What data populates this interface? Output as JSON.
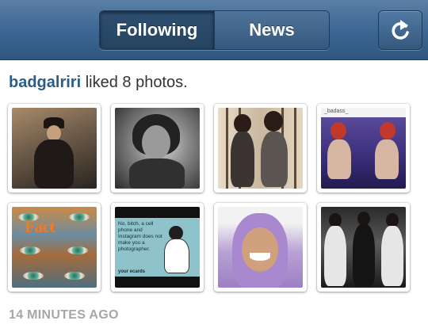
{
  "nav": {
    "tabs": [
      {
        "label": "Following",
        "active": true
      },
      {
        "label": "News",
        "active": false
      }
    ],
    "refresh_icon": "refresh-icon",
    "colors": {
      "bar_top": "#5b7fa5",
      "bar_bottom": "#2d567f"
    }
  },
  "activity": {
    "username": "badgalriri",
    "action": " liked 8 photos.",
    "username_color": "#2c5d87"
  },
  "photos": [
    {
      "subject": "woman-in-hat-photo"
    },
    {
      "subject": "black-and-white-portrait-photo"
    },
    {
      "subject": "two-women-posing-photo"
    },
    {
      "subject": "mirrored-dancer-photo",
      "overlay_text": "_badass_"
    },
    {
      "subject": "eyes-collage-photo",
      "overlay_text": "Fact"
    },
    {
      "subject": "ecard-photo",
      "overlay_text": "No, bitch, a cell phone and Instagram does not make you a photographer.",
      "brand_text": "your ecards"
    },
    {
      "subject": "smiling-man-purple-hair-photo"
    },
    {
      "subject": "three-women-black-outfits-photo"
    }
  ],
  "timestamp": "14 MINUTES AGO"
}
